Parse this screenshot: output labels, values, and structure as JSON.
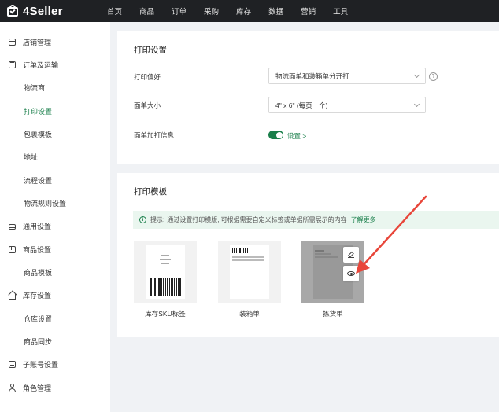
{
  "brand": {
    "name": "4Seller"
  },
  "nav": [
    "首页",
    "商品",
    "订单",
    "采购",
    "库存",
    "数据",
    "营销",
    "工具"
  ],
  "sidebar": {
    "items": [
      {
        "label": "店铺管理",
        "type": "parent",
        "icon": "store-icon"
      },
      {
        "label": "订单及运输",
        "type": "parent",
        "icon": "clipboard-icon"
      },
      {
        "label": "物流商",
        "type": "child"
      },
      {
        "label": "打印设置",
        "type": "child",
        "active": true
      },
      {
        "label": "包裹模板",
        "type": "child"
      },
      {
        "label": "地址",
        "type": "child"
      },
      {
        "label": "流程设置",
        "type": "child"
      },
      {
        "label": "物流规则设置",
        "type": "child"
      },
      {
        "label": "通用设置",
        "type": "parent",
        "icon": "printer-icon"
      },
      {
        "label": "商品设置",
        "type": "parent",
        "icon": "box-icon"
      },
      {
        "label": "商品模板",
        "type": "child"
      },
      {
        "label": "库存设置",
        "type": "parent",
        "icon": "warehouse-icon"
      },
      {
        "label": "仓库设置",
        "type": "child"
      },
      {
        "label": "商品同步",
        "type": "child"
      },
      {
        "label": "子账号设置",
        "type": "parent",
        "icon": "sub-account-icon"
      },
      {
        "label": "角色管理",
        "type": "parent",
        "icon": "user-icon"
      }
    ]
  },
  "print_settings": {
    "title": "打印设置",
    "preference_label": "打印偏好",
    "preference_value": "物流面单和装箱单分开打",
    "size_label": "面单大小",
    "size_value": "4\" x 6\" (每页一个)",
    "extra_label": "面单加打信息",
    "extra_enabled": true,
    "extra_link": "设置 >"
  },
  "print_templates": {
    "title": "打印模板",
    "tip_prefix": "提示:",
    "tip_text": "通过设置打印模版, 可根据需要自定义标签或单据所需展示的内容",
    "tip_link": "了解更多",
    "templates": [
      {
        "label": "库存SKU标签"
      },
      {
        "label": "装箱单"
      },
      {
        "label": "拣货单"
      }
    ]
  },
  "colors": {
    "accent": "#1a7f4b",
    "topbar": "#1f2124",
    "arrow": "#e8463a"
  }
}
